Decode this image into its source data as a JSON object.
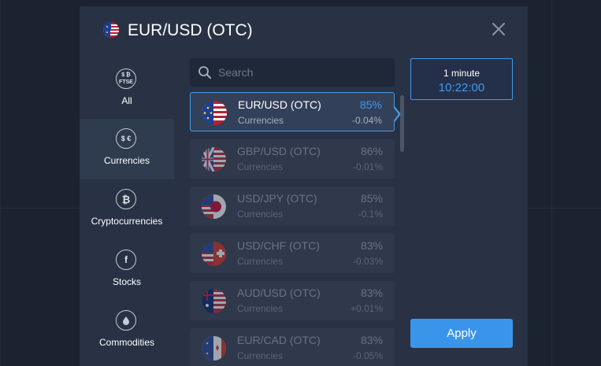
{
  "header": {
    "title": "EUR/USD (OTC)",
    "flag_icon": "eu-us-flag-icon",
    "close_icon": "close-icon"
  },
  "categories": [
    {
      "label": "All",
      "icon": "all-assets-icon",
      "icon_text": "$ ₿\nFTSE",
      "active": false
    },
    {
      "label": "Currencies",
      "icon": "currencies-icon",
      "icon_text": "$ €",
      "active": true
    },
    {
      "label": "Cryptocurrencies",
      "icon": "bitcoin-icon",
      "icon_text": "₿",
      "active": false
    },
    {
      "label": "Stocks",
      "icon": "stocks-icon",
      "icon_text": "f",
      "active": false
    },
    {
      "label": "Commodities",
      "icon": "commodities-drop-icon",
      "icon_text": "",
      "active": false
    }
  ],
  "search": {
    "placeholder": "Search",
    "value": ""
  },
  "assets": [
    {
      "name": "EUR/USD (OTC)",
      "category": "Currencies",
      "payout": "85%",
      "change": "-0.04%",
      "selected": true,
      "flag": "eu-us-flag-icon"
    },
    {
      "name": "GBP/USD (OTC)",
      "category": "Currencies",
      "payout": "86%",
      "change": "-0.01%",
      "selected": false,
      "flag": "gb-us-flag-icon"
    },
    {
      "name": "USD/JPY (OTC)",
      "category": "Currencies",
      "payout": "85%",
      "change": "-0.1%",
      "selected": false,
      "flag": "us-jp-flag-icon"
    },
    {
      "name": "USD/CHF (OTC)",
      "category": "Currencies",
      "payout": "83%",
      "change": "-0.03%",
      "selected": false,
      "flag": "us-ch-flag-icon"
    },
    {
      "name": "AUD/USD (OTC)",
      "category": "Currencies",
      "payout": "83%",
      "change": "+0.01%",
      "selected": false,
      "flag": "au-us-flag-icon"
    },
    {
      "name": "EUR/CAD (OTC)",
      "category": "Currencies",
      "payout": "83%",
      "change": "-0.05%",
      "selected": false,
      "flag": "eu-ca-flag-icon"
    }
  ],
  "expiry": {
    "label": "1 minute",
    "time": "10:22:00"
  },
  "apply_label": "Apply",
  "colors": {
    "accent": "#3d9af0",
    "modal_bg": "#283244",
    "page_bg": "#1b2230"
  }
}
